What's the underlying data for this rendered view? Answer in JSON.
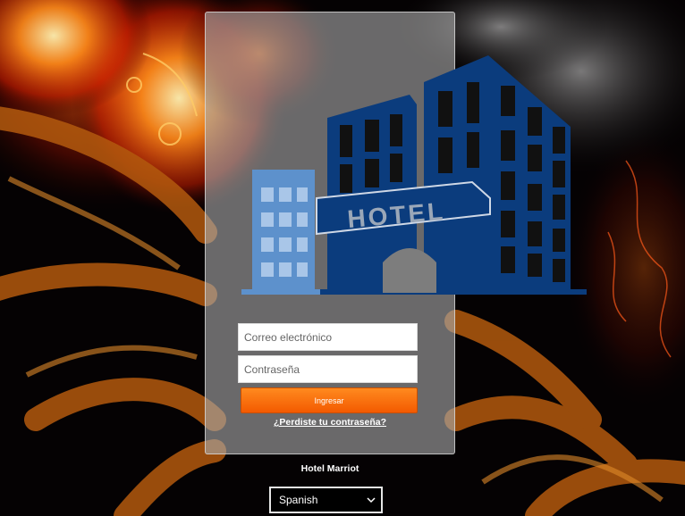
{
  "login": {
    "email_placeholder": "Correo electrónico",
    "password_placeholder": "Contraseña",
    "submit_label": "Ingresar",
    "forgot_link": "¿Perdiste tu contraseña?"
  },
  "logo": {
    "text": "HOTEL"
  },
  "footer": {
    "hotel_name": "Hotel Marriot",
    "language_selected": "Spanish"
  },
  "colors": {
    "accent": "#ff7a10",
    "logo_dark": "#0b3c7d",
    "logo_light": "#5d91cc"
  }
}
